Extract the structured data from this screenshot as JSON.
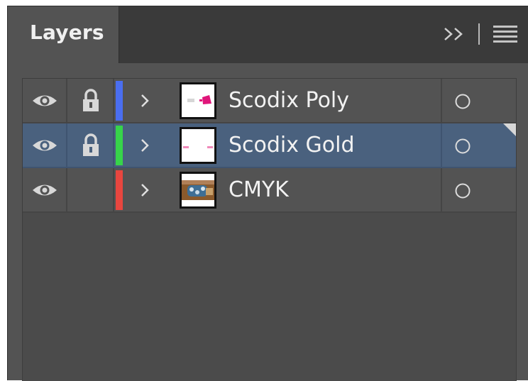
{
  "panel": {
    "tab_label": "Layers",
    "collapse_icon": "double-chevron-right-icon",
    "menu_icon": "hamburger-menu-icon"
  },
  "layers": [
    {
      "name": "Scodix Poly",
      "color": "#4a6ef0",
      "visible": true,
      "locked": true,
      "selected": false,
      "thumbnail": "poly"
    },
    {
      "name": "Scodix Gold",
      "color": "#37d44a",
      "visible": true,
      "locked": true,
      "selected": true,
      "thumbnail": "gold"
    },
    {
      "name": "CMYK",
      "color": "#e8463f",
      "visible": true,
      "locked": false,
      "selected": false,
      "thumbnail": "photo"
    }
  ],
  "colors": {
    "panel_bg": "#535353",
    "selected_row": "#4a617e",
    "text": "#f2f2f2"
  }
}
